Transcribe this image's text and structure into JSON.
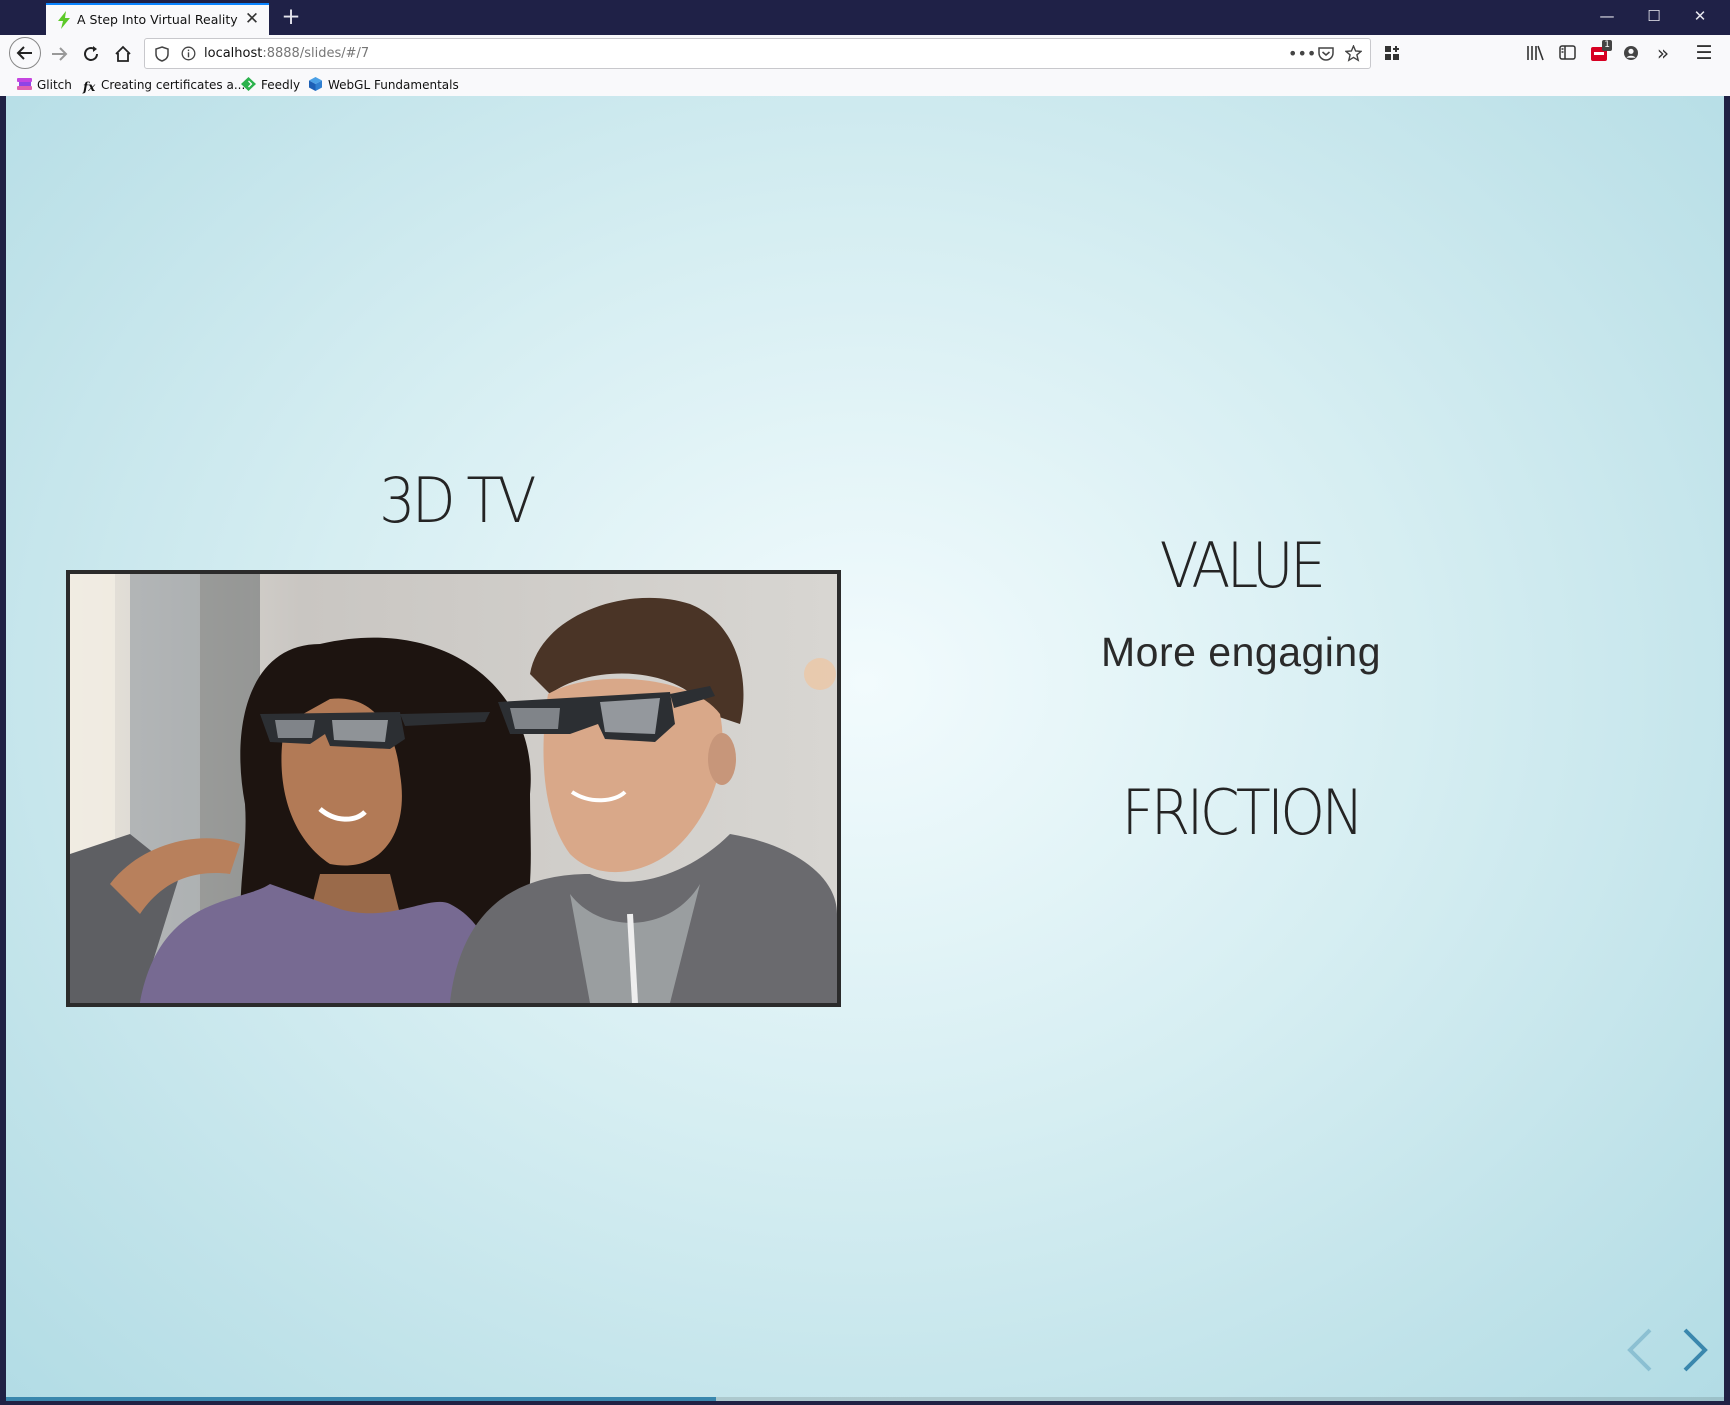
{
  "browser": {
    "tab_title": "A Step Into Virtual Reality",
    "url_host": "localhost",
    "url_rest": ":8888/slides/#/7",
    "extension_badge": "1",
    "bookmarks": [
      {
        "label": "Glitch"
      },
      {
        "label": "Creating certificates a..."
      },
      {
        "label": "Feedly"
      },
      {
        "label": "WebGL Fundamentals"
      }
    ]
  },
  "slide": {
    "left_heading": "3D TV",
    "value_heading": "VALUE",
    "value_text": "More engaging",
    "friction_heading": "FRICTION",
    "progress": 0.413
  },
  "colors": {
    "accent": "#0a84ff",
    "titlebar": "#1f2147",
    "progress": "#3a87ad",
    "controls": "#3a87ad"
  },
  "icons": {
    "back": "arrow-left-icon",
    "forward": "arrow-right-icon",
    "reload": "reload-icon",
    "home": "home-icon",
    "prev_slide": "chevron-left-icon",
    "next_slide": "chevron-right-icon"
  }
}
